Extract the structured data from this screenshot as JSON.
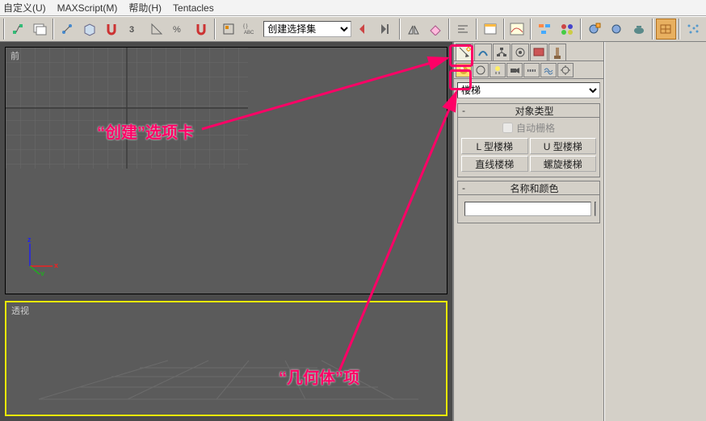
{
  "menu": {
    "customize": "自定义(U)",
    "maxscript": "MAXScript(M)",
    "help": "帮助(H)",
    "tentacles": "Tentacles"
  },
  "toolbar": {
    "selectionSet": "创建选择集"
  },
  "viewports": {
    "front": "前",
    "perspective": "透视"
  },
  "axis": {
    "x": "x",
    "y": "y",
    "z": "z"
  },
  "panel": {
    "categoryDropdown": "楼梯",
    "rolloutObjectType": "对象类型",
    "autoGrid": "自动栅格",
    "buttons": {
      "lStair": "L 型楼梯",
      "uStair": "U 型楼梯",
      "straightStair": "直线楼梯",
      "spiralStair": "螺旋楼梯"
    },
    "rolloutNameColor": "名称和颜色"
  },
  "annot": {
    "create": "“创建”选项卡",
    "geometry": "“几何体”项"
  }
}
